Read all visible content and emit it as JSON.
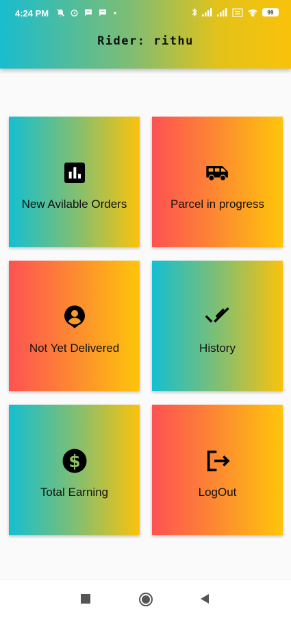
{
  "status_bar": {
    "time": "4:24 PM",
    "left_icons": [
      "mute-icon",
      "alarm-icon",
      "message-icon",
      "message-icon",
      "dot-icon"
    ],
    "right_icons": [
      "bluetooth-icon",
      "signal-icon",
      "signal-icon",
      "volte-icon",
      "wifi-icon"
    ],
    "battery": "99"
  },
  "app_bar": {
    "title": "Rider: rithu"
  },
  "tiles": [
    {
      "label": "New Avilable Orders",
      "icon": "bar-chart-icon",
      "gradient": "teal"
    },
    {
      "label": "Parcel in progress",
      "icon": "van-icon",
      "gradient": "red"
    },
    {
      "label": "Not Yet Delivered",
      "icon": "person-pin-icon",
      "gradient": "red"
    },
    {
      "label": "History",
      "icon": "double-check-icon",
      "gradient": "teal"
    },
    {
      "label": "Total Earning",
      "icon": "dollar-icon",
      "gradient": "teal"
    },
    {
      "label": "LogOut",
      "icon": "logout-icon",
      "gradient": "red"
    }
  ],
  "nav_bar": {
    "buttons": [
      "recents-icon",
      "home-icon",
      "back-icon"
    ]
  },
  "colors": {
    "teal": "#14bfd0",
    "red": "#fd5252",
    "yellow": "#fec50a",
    "text": "#111111"
  }
}
